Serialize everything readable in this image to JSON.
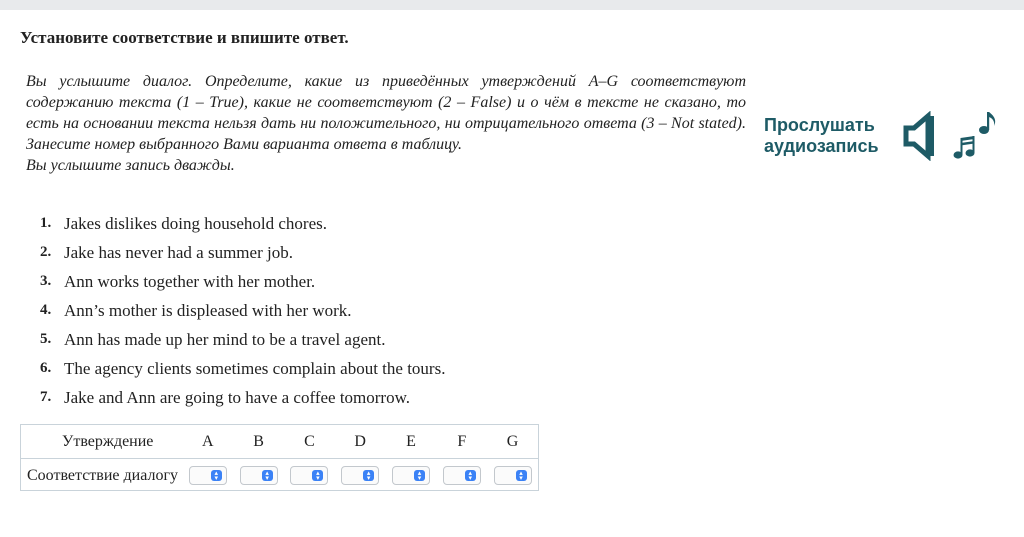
{
  "task": {
    "title": "Установите соответствие и впишите ответ.",
    "instruction_lines": [
      "Вы услышите диалог. Определите, какие из приведённых утверждений A–G соответствуют содержанию текста (1 – True), какие не соответствуют (2 – False) и о чём в тексте не сказано, то есть на основании текста нельзя дать ни положительного, ни отрицательного ответа (3 – Not stated). Занесите номер выбранного Вами варианта ответа в таблицу.",
      "Вы услышите запись дважды."
    ]
  },
  "audio": {
    "label": "Прослушать аудиозапись",
    "icons": [
      "speaker-icon",
      "music-notes-icon"
    ]
  },
  "statements": [
    {
      "num": "1.",
      "text": "Jakes dislikes doing household chores."
    },
    {
      "num": "2.",
      "text": "Jake has never had a summer job."
    },
    {
      "num": "3.",
      "text": "Ann works together with her mother."
    },
    {
      "num": "4.",
      "text": "Ann’s mother is displeased with her work."
    },
    {
      "num": "5.",
      "text": "Ann has made up her mind to be a travel agent."
    },
    {
      "num": "6.",
      "text": "The agency clients sometimes complain about the tours."
    },
    {
      "num": "7.",
      "text": "Jake and Ann are going to have a coffee tomorrow."
    }
  ],
  "answer_table": {
    "header_label": "Утверждение",
    "row_label": "Соответствие диалогу",
    "letters": [
      "A",
      "B",
      "C",
      "D",
      "E",
      "F",
      "G"
    ],
    "selected_values": [
      "",
      "",
      "",
      "",
      "",
      "",
      ""
    ]
  },
  "colors": {
    "accent": "#1e5b66",
    "select_arrow": "#3b82f6",
    "border": "#c9d3da"
  }
}
